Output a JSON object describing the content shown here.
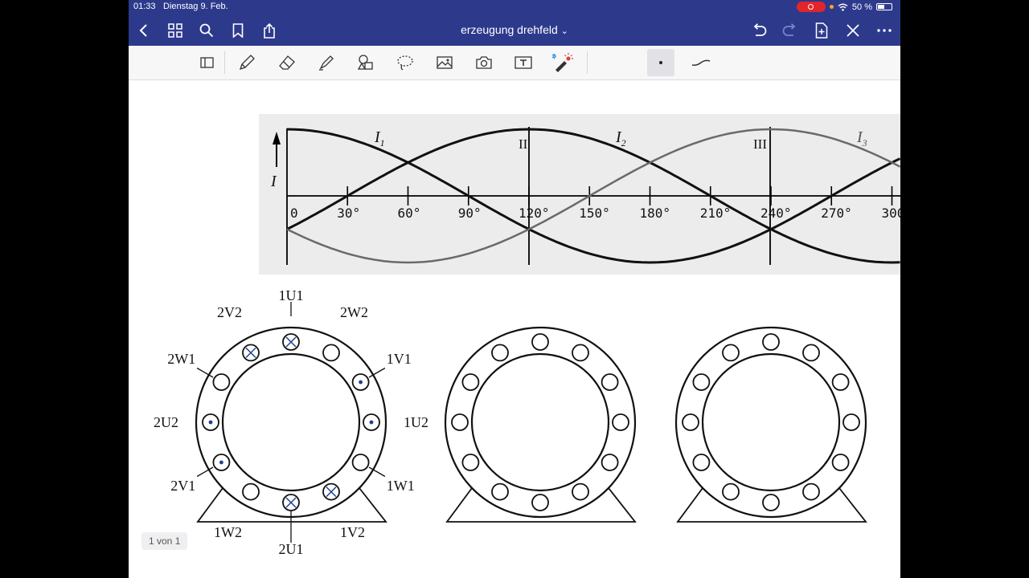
{
  "status": {
    "time": "01:33",
    "date": "Dienstag 9. Feb.",
    "battery": "50 %"
  },
  "nav": {
    "title": "erzeugung drehfeld",
    "title_arrow": "⌄"
  },
  "graph": {
    "i1": "I",
    "i1_sub": "1",
    "i2": "I",
    "i2_sub": "2",
    "i3": "I",
    "i3_sub": "3",
    "y_label": "I",
    "marker2": "II",
    "marker3": "III",
    "ticks": [
      "0",
      "30°",
      "60°",
      "90°",
      "120°",
      "150°",
      "180°",
      "210°",
      "240°",
      "270°",
      "300"
    ]
  },
  "motor1": {
    "labels": [
      "1U1",
      "2W2",
      "1V1",
      "1U2",
      "1W1",
      "1V2",
      "2U1",
      "1W2",
      "2V1",
      "2U2",
      "2W1",
      "2V2"
    ]
  },
  "page_indicator": "1 von 1"
}
